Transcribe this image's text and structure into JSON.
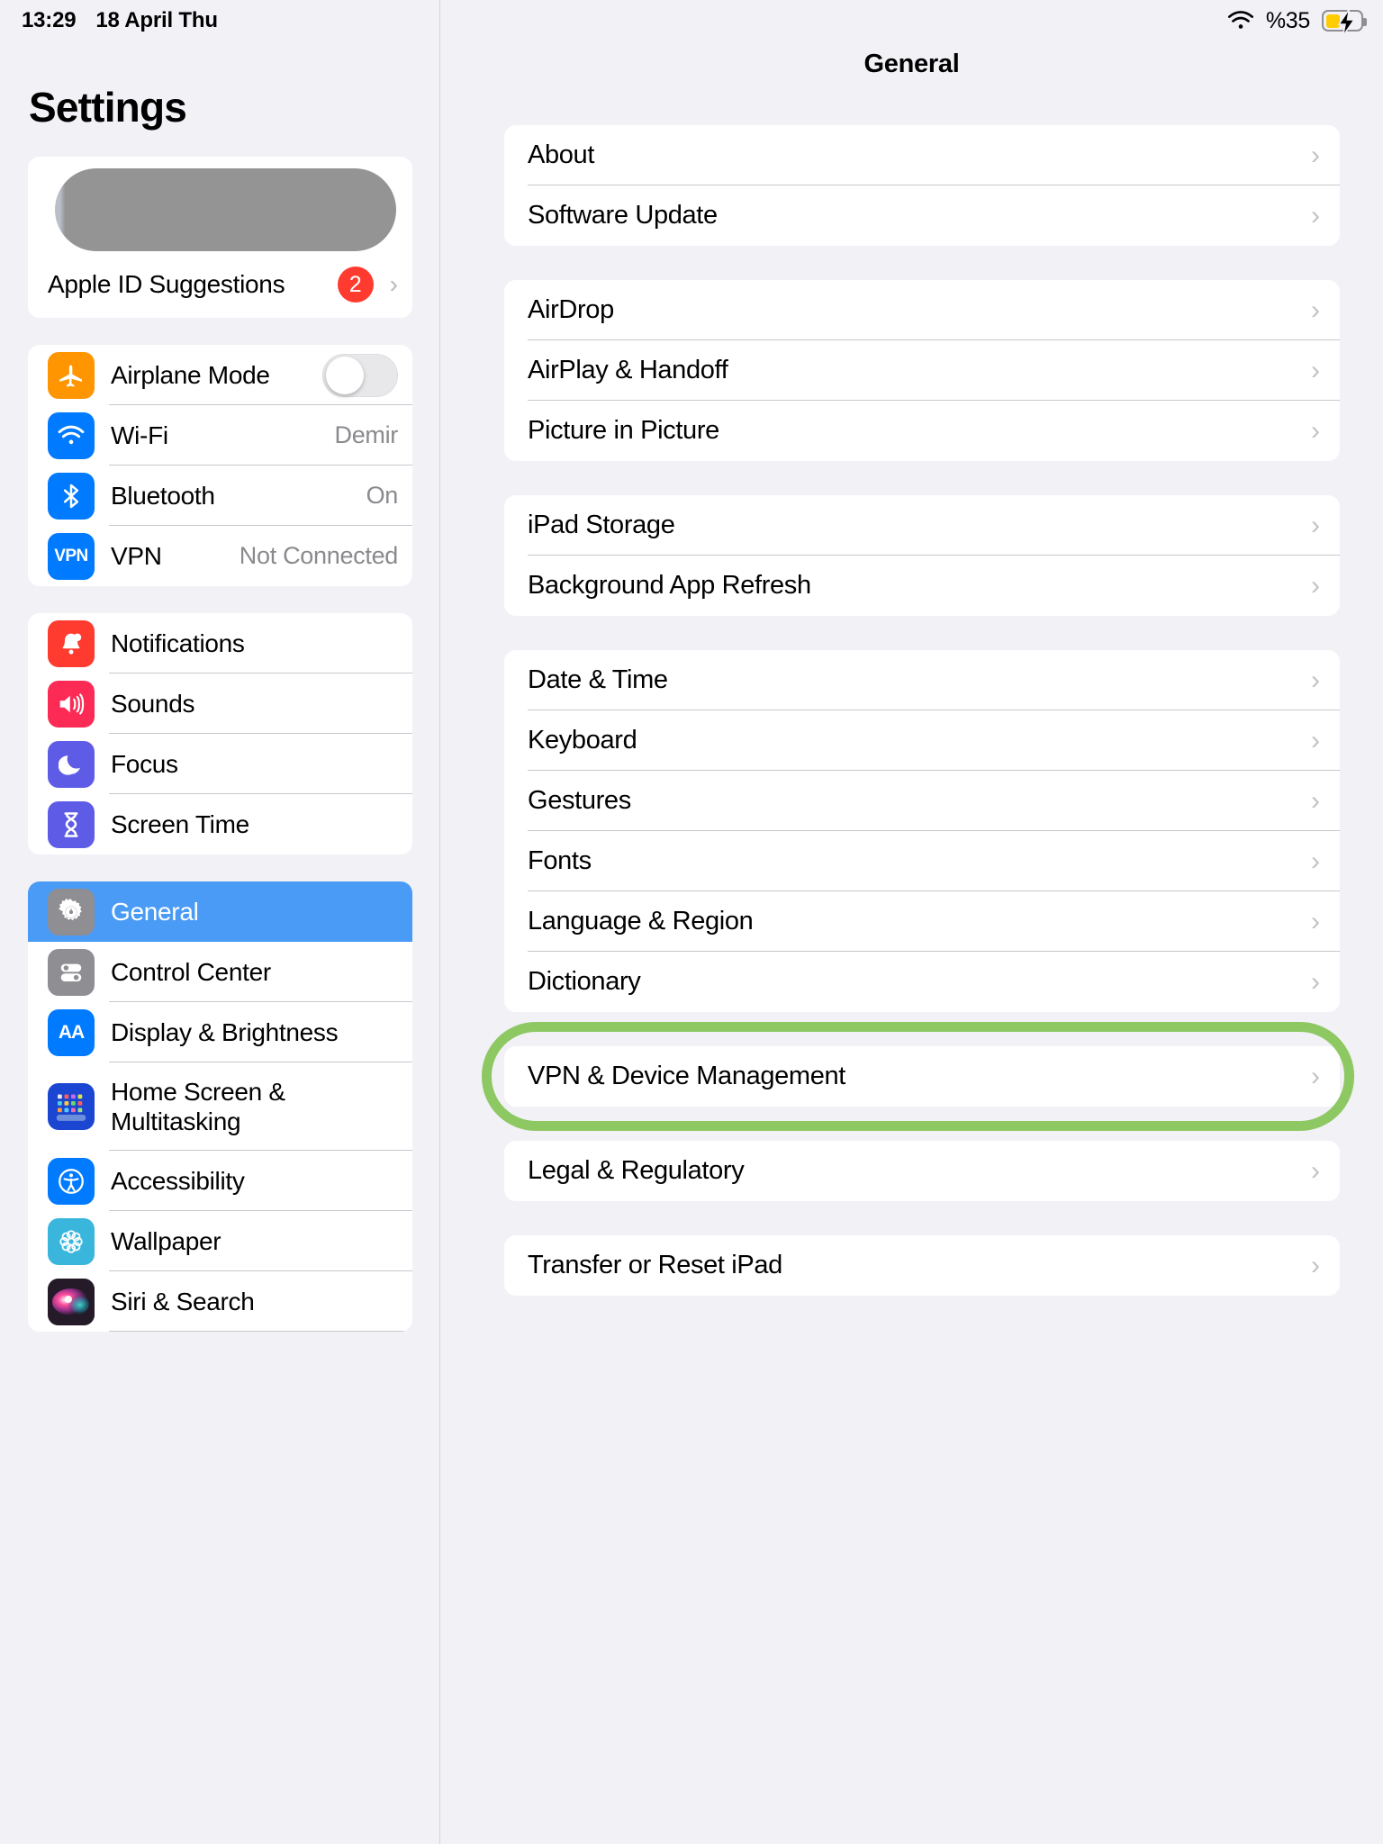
{
  "statusbar": {
    "time": "13:29",
    "date": "18 April Thu",
    "battery_percent": "%35",
    "wifi_icon": "wifi-icon",
    "battery_icon": "battery-charging-icon"
  },
  "sidebar": {
    "title": "Settings",
    "account": {
      "redacted": true,
      "suggestions_label": "Apple ID Suggestions",
      "badge": "2",
      "chevron": "›"
    },
    "groups": [
      {
        "items": [
          {
            "label": "Airplane Mode",
            "icon": "airplane-icon",
            "icon_color": "#ff9500",
            "control": "toggle",
            "toggle_on": false
          },
          {
            "label": "Wi-Fi",
            "icon": "wifi-icon",
            "icon_color": "#007aff",
            "value": "Demir"
          },
          {
            "label": "Bluetooth",
            "icon": "bluetooth-icon",
            "icon_color": "#007aff",
            "value": "On"
          },
          {
            "label": "VPN",
            "icon": "vpn-icon",
            "icon_color": "#007aff",
            "value": "Not Connected"
          }
        ]
      },
      {
        "items": [
          {
            "label": "Notifications",
            "icon": "bell-icon",
            "icon_color": "#ff3b30"
          },
          {
            "label": "Sounds",
            "icon": "speaker-icon",
            "icon_color": "#fc2b55"
          },
          {
            "label": "Focus",
            "icon": "moon-icon",
            "icon_color": "#5e5ce6"
          },
          {
            "label": "Screen Time",
            "icon": "hourglass-icon",
            "icon_color": "#5e5ce6"
          }
        ]
      },
      {
        "items": [
          {
            "label": "General",
            "icon": "gear-icon",
            "icon_color": "#8e8e93",
            "selected": true
          },
          {
            "label": "Control Center",
            "icon": "sliders-icon",
            "icon_color": "#8e8e93"
          },
          {
            "label": "Display & Brightness",
            "icon": "aa-icon",
            "icon_color": "#007aff"
          },
          {
            "label": "Home Screen & Multitasking",
            "icon": "home-grid-icon",
            "icon_color": "#1a46d2"
          },
          {
            "label": "Accessibility",
            "icon": "accessibility-icon",
            "icon_color": "#007aff"
          },
          {
            "label": "Wallpaper",
            "icon": "flower-icon",
            "icon_color": "#3ab6dd"
          },
          {
            "label": "Siri & Search",
            "icon": "siri-icon",
            "icon_color": "#2a1f2e"
          }
        ]
      }
    ],
    "selected_accent": "#4a9bf5"
  },
  "detail": {
    "title": "General",
    "chevron": "›",
    "highlight_color": "#8dc863",
    "groups": [
      {
        "items": [
          {
            "label": "About"
          },
          {
            "label": "Software Update"
          }
        ]
      },
      {
        "items": [
          {
            "label": "AirDrop"
          },
          {
            "label": "AirPlay & Handoff"
          },
          {
            "label": "Picture in Picture"
          }
        ]
      },
      {
        "items": [
          {
            "label": "iPad Storage"
          },
          {
            "label": "Background App Refresh"
          }
        ]
      },
      {
        "items": [
          {
            "label": "Date & Time"
          },
          {
            "label": "Keyboard"
          },
          {
            "label": "Gestures"
          },
          {
            "label": "Fonts"
          },
          {
            "label": "Language & Region"
          },
          {
            "label": "Dictionary"
          }
        ]
      },
      {
        "highlighted": true,
        "items": [
          {
            "label": "VPN & Device Management"
          }
        ]
      },
      {
        "items": [
          {
            "label": "Legal & Regulatory"
          }
        ]
      },
      {
        "items": [
          {
            "label": "Transfer or Reset iPad"
          }
        ]
      }
    ]
  }
}
